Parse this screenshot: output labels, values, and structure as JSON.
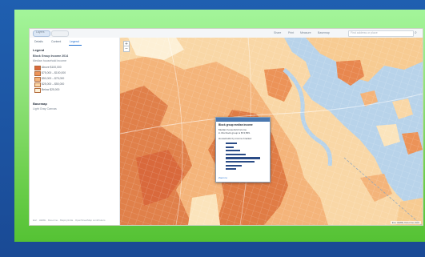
{
  "app": {
    "title": "Map Viewer"
  },
  "toolbar": {
    "left_tab_label": "Layers",
    "right_items": [
      "Share",
      "Print",
      "Measure",
      "Basemap"
    ],
    "search_placeholder": "Find address or place"
  },
  "sidebar": {
    "tabs": [
      "Details",
      "Content",
      "Legend"
    ],
    "active_tab": "Legend",
    "heading": "Legend",
    "layer_title": "Block Group Income 2014",
    "layer_subtitle": "Median household income",
    "legend_items": [
      {
        "label": "Above $100,000",
        "color": "#d9693c"
      },
      {
        "label": "$75,000 – $100,000",
        "color": "#ec9358"
      },
      {
        "label": "$50,000 – $75,000",
        "color": "#f4b47a"
      },
      {
        "label": "$25,000 – $50,000",
        "color": "#f9d4a4"
      },
      {
        "label": "Below $25,000",
        "color": "#fdf0d6"
      }
    ],
    "section2_heading": "Basemap",
    "section2_text": "Light Gray Canvas",
    "footer": "Esri · HERE · DeLorme · MapmyIndia · OpenStreetMap contributors"
  },
  "popup": {
    "title": "Block group median income",
    "line1": "Median household income",
    "line2": "in this block group is $74,569.",
    "line3": "Households by income bracket:",
    "footer": "Zoom to",
    "bars": [
      0.3,
      0.22,
      0.4,
      0.55,
      0.95,
      0.8,
      0.45,
      0.28
    ]
  },
  "map": {
    "attribution": "Esri, HERE, DeLorme | Esri",
    "zoom_in": "+",
    "zoom_out": "−"
  },
  "colors": {
    "panel_green": "#8fe27a",
    "slide_blue": "#1f5fb0",
    "water": "#b8d3ea",
    "income_high": "#d9693c",
    "income_mid": "#f4b47a",
    "income_low": "#fdf0d6"
  }
}
